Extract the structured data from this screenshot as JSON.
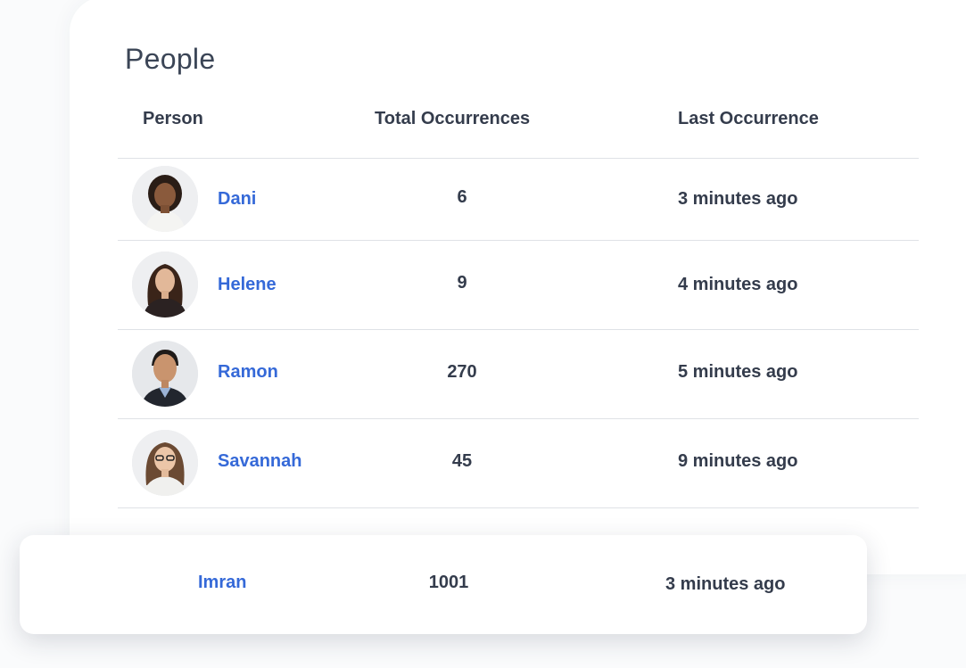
{
  "title": "People",
  "columns": {
    "person": "Person",
    "total": "Total Occurrences",
    "last": "Last Occurrence"
  },
  "rows": [
    {
      "name": "Dani",
      "count": "6",
      "last": "3 minutes ago",
      "avatar": "avatar-dani"
    },
    {
      "name": "Helene",
      "count": "9",
      "last": "4 minutes ago",
      "avatar": "avatar-helene"
    },
    {
      "name": "Ramon",
      "count": "270",
      "last": "5 minutes ago",
      "avatar": "avatar-ramon"
    },
    {
      "name": "Savannah",
      "count": "45",
      "last": "9 minutes ago",
      "avatar": "avatar-savannah"
    }
  ],
  "highlight": {
    "name": "Imran",
    "count": "1001",
    "last": "3 minutes ago"
  },
  "colors": {
    "link": "#3569d8",
    "text": "#343c4c",
    "divider": "#dfe2e6"
  }
}
